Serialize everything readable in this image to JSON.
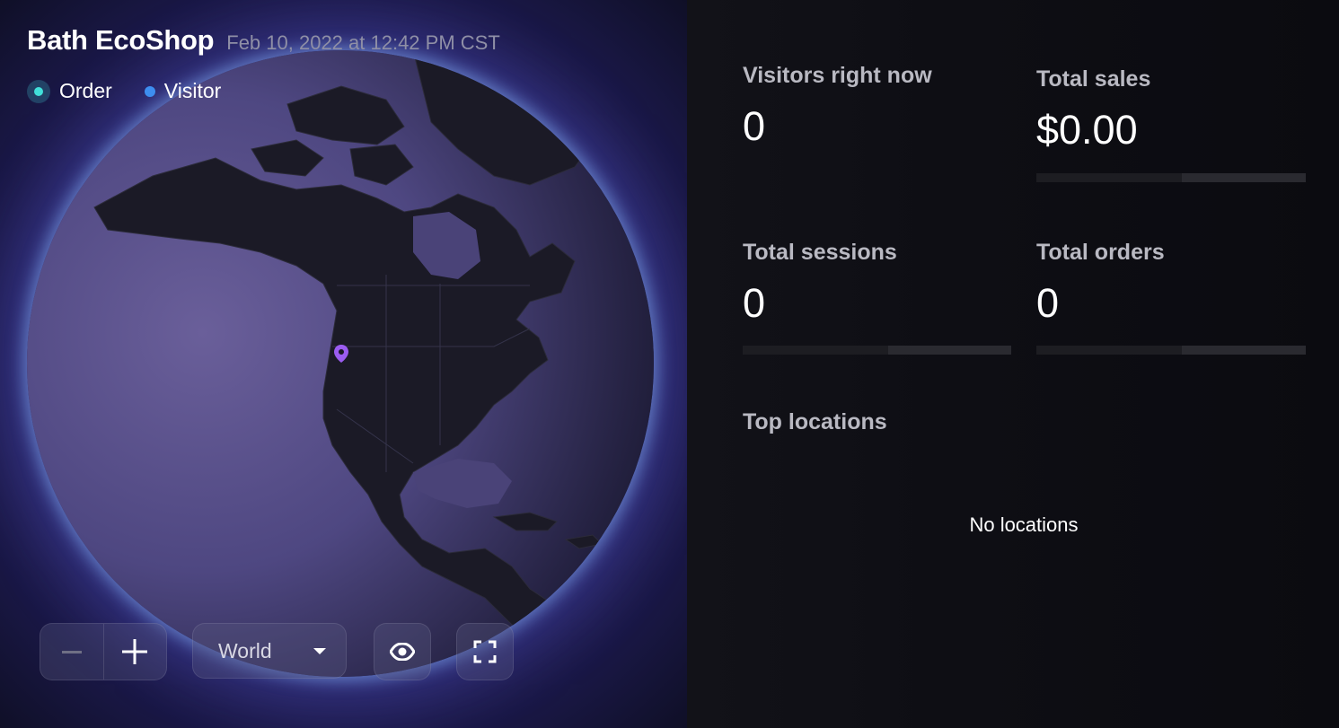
{
  "header": {
    "shop_name": "Bath EcoShop",
    "timestamp": "Feb 10, 2022 at 12:42 PM CST"
  },
  "legend": {
    "order_label": "Order",
    "visitor_label": "Visitor",
    "order_color": "#41e0d9",
    "visitor_color": "#3d8ef0"
  },
  "map": {
    "marker_color": "#9b5cf0",
    "icons": [
      "location-pin-icon"
    ]
  },
  "controls": {
    "zoom_out_label": "−",
    "zoom_in_label": "+",
    "region_value": "World",
    "icons": [
      "minus-icon",
      "plus-icon",
      "chevron-down-icon",
      "eye-icon",
      "fullscreen-icon"
    ]
  },
  "metrics": {
    "visitors": {
      "label": "Visitors right now",
      "value": "0"
    },
    "sales": {
      "label": "Total sales",
      "value": "$0.00"
    },
    "sessions": {
      "label": "Total sessions",
      "value": "0"
    },
    "orders": {
      "label": "Total orders",
      "value": "0"
    }
  },
  "top_locations": {
    "title": "Top locations",
    "empty_message": "No locations"
  },
  "colors": {
    "background": "#0b0b14",
    "accent_order": "#41e0d9",
    "accent_visitor": "#3d8ef0",
    "marker": "#9b5cf0"
  }
}
